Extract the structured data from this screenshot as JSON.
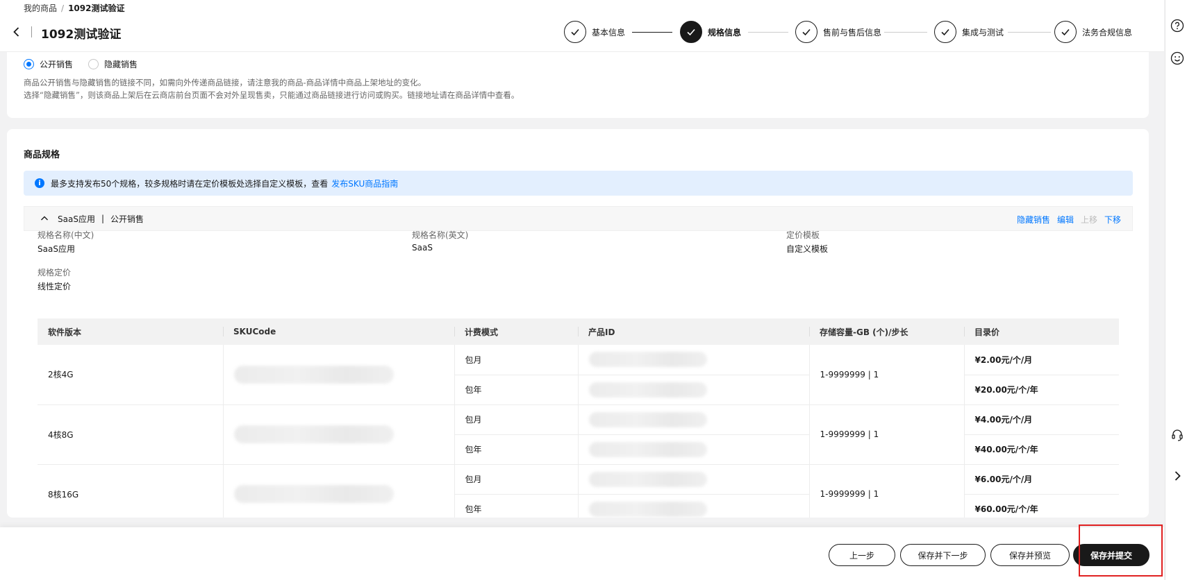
{
  "breadcrumb": {
    "parent": "我的商品",
    "separator": "/",
    "current": "1092测试验证"
  },
  "page_title": "1092测试验证",
  "steps": [
    {
      "label": "基本信息",
      "state": "done"
    },
    {
      "label": "规格信息",
      "state": "active"
    },
    {
      "label": "售前与售后信息",
      "state": "done"
    },
    {
      "label": "集成与测试",
      "state": "done"
    },
    {
      "label": "法务合规信息",
      "state": "done"
    }
  ],
  "visibility": {
    "options": [
      "公开销售",
      "隐藏销售"
    ],
    "selected": "公开销售",
    "desc_line1": "商品公开销售与隐藏销售的链接不同，如需向外传递商品链接，请注意我的商品-商品详情中商品上架地址的变化。",
    "desc_line2": "选择“隐藏销售”，则该商品上架后在云商店前台页面不会对外呈现售卖，只能通过商品链接进行访问或购买。链接地址请在商品详情中查看。"
  },
  "spec_section": {
    "title": "商品规格",
    "notice_text": "最多支持发布50个规格，较多规格时请在定价模板处选择自定义模板，查看",
    "notice_link": "发布SKU商品指南",
    "spec_name": "SaaS应用",
    "spec_sep": "|",
    "spec_sale": "公开销售",
    "actions": {
      "hide": "隐藏销售",
      "edit": "编辑",
      "up": "上移",
      "down": "下移"
    },
    "fields": {
      "name_cn_label": "规格名称(中文)",
      "name_cn_value": "SaaS应用",
      "name_en_label": "规格名称(英文)",
      "name_en_value": "SaaS",
      "template_label": "定价模板",
      "template_value": "自定义模板",
      "pricing_label": "规格定价",
      "pricing_value": "线性定价"
    },
    "table": {
      "columns": [
        "软件版本",
        "SKUCode",
        "计费模式",
        "产品ID",
        "存储容量-GB (个)/步长",
        "目录价"
      ],
      "rows": [
        {
          "version": "2核4G",
          "capacity": "1-9999999 | 1",
          "modes": [
            "包月",
            "包年"
          ],
          "prices": [
            "¥2.00元/个/月",
            "¥20.00元/个/年"
          ]
        },
        {
          "version": "4核8G",
          "capacity": "1-9999999 | 1",
          "modes": [
            "包月",
            "包年"
          ],
          "prices": [
            "¥4.00元/个/月",
            "¥40.00元/个/年"
          ]
        },
        {
          "version": "8核16G",
          "capacity": "1-9999999 | 1",
          "modes": [
            "包月",
            "包年"
          ],
          "prices": [
            "¥6.00元/个/月",
            "¥60.00元/个/年"
          ]
        }
      ]
    }
  },
  "footer": {
    "prev": "上一步",
    "save_next": "保存并下一步",
    "save_preview": "保存并预览",
    "save_submit": "保存并提交"
  },
  "icons": {
    "back": "chevron-left-icon",
    "check": "check-icon",
    "help": "help-circle-icon",
    "feedback": "smile-icon",
    "service": "headset-icon",
    "expand": "chevron-right-icon"
  }
}
